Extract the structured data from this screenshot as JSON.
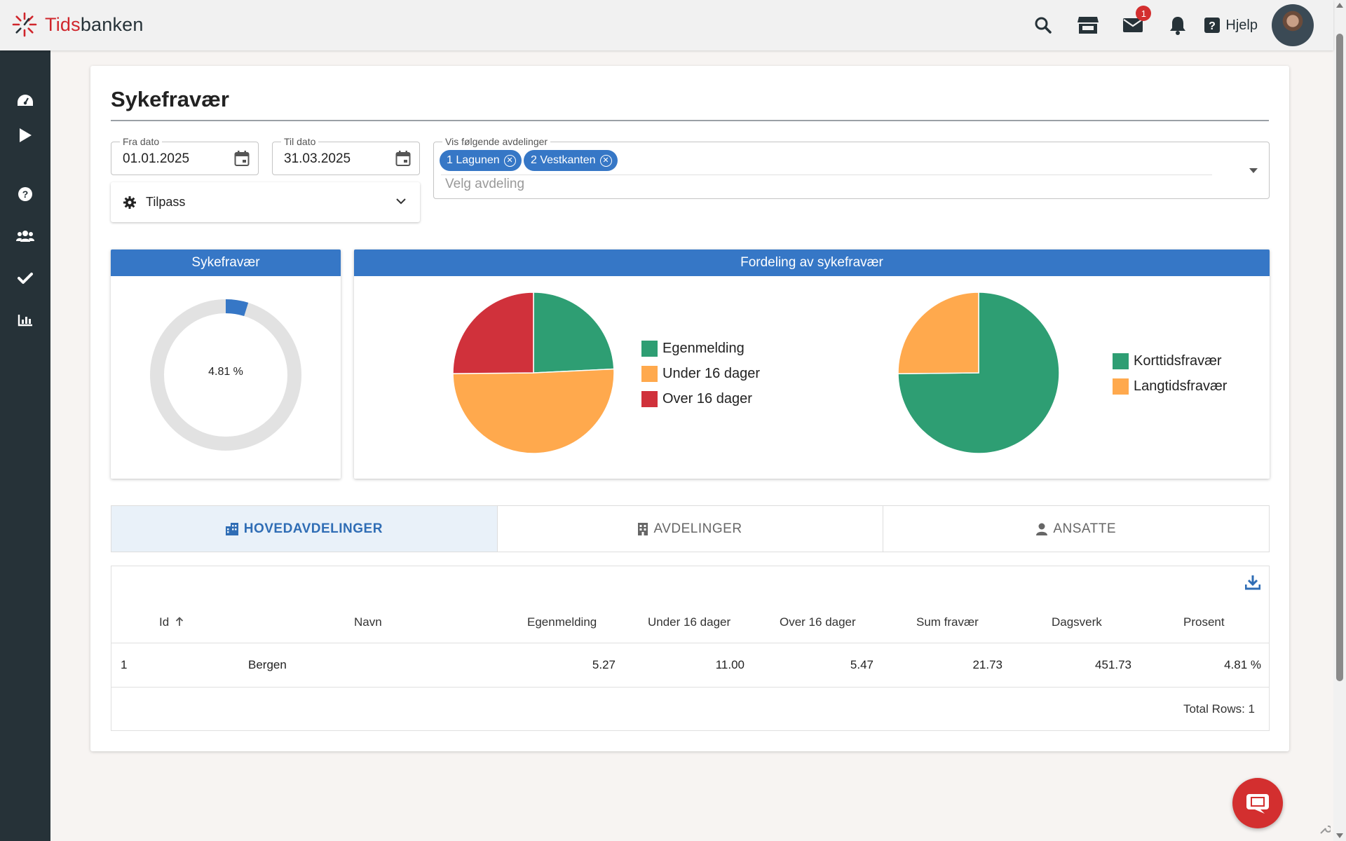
{
  "app": {
    "logo_red": "Tids",
    "logo_dark": "banken",
    "help_label": "Hjelp",
    "mail_badge": "1"
  },
  "icons": {
    "top": [
      "search-icon",
      "store-icon",
      "mail-icon",
      "bell-icon",
      "help-icon"
    ],
    "sidebar": [
      "dashboard-icon",
      "play-icon",
      "help-circle-icon",
      "users-icon",
      "check-icon",
      "chart-icon"
    ]
  },
  "page": {
    "title": "Sykefravær"
  },
  "filters": {
    "from_label": "Fra dato",
    "from_value": "01.01.2025",
    "to_label": "Til dato",
    "to_value": "31.03.2025",
    "customize_label": "Tilpass",
    "departments_label": "Vis følgende avdelinger",
    "departments_placeholder": "Velg avdeling",
    "chips": [
      "1 Lagunen",
      "2 Vestkanten"
    ]
  },
  "panels": {
    "sickleave_title": "Sykefravær",
    "distribution_title": "Fordeling av sykefravær",
    "donut_label": "4.81 %"
  },
  "colors": {
    "accent": "#3677c6",
    "green": "#2e9e73",
    "orange": "#ffa94d",
    "red": "#d0313b",
    "gray_ring": "#e2e2e2",
    "sidebar": "#263238"
  },
  "chart_data": [
    {
      "type": "pie",
      "variant": "donut",
      "title": "Sykefravær",
      "value_percent": 4.81,
      "center_label": "4.81 %"
    },
    {
      "type": "pie",
      "labels": [
        "Egenmelding",
        "Under 16 dager",
        "Over 16 dager"
      ],
      "values": [
        5.27,
        11.0,
        5.47
      ],
      "colors": [
        "#2e9e73",
        "#ffa94d",
        "#d0313b"
      ]
    },
    {
      "type": "pie",
      "labels": [
        "Korttidsfravær",
        "Langtidsfravær"
      ],
      "values": [
        16.26,
        5.47
      ],
      "colors": [
        "#2e9e73",
        "#ffa94d"
      ]
    }
  ],
  "tabs": [
    {
      "label": "HOVEDAVDELINGER",
      "active": true,
      "icon": "building-grid-icon"
    },
    {
      "label": "AVDELINGER",
      "active": false,
      "icon": "building-icon"
    },
    {
      "label": "ANSATTE",
      "active": false,
      "icon": "person-icon"
    }
  ],
  "table": {
    "columns": [
      "Id",
      "Navn",
      "Egenmelding",
      "Under 16 dager",
      "Over 16 dager",
      "Sum fravær",
      "Dagsverk",
      "Prosent"
    ],
    "rows": [
      [
        "1",
        "Bergen",
        "5.27",
        "11.00",
        "5.47",
        "21.73",
        "451.73",
        "4.81 %"
      ]
    ],
    "total_rows": "Total Rows: 1"
  }
}
